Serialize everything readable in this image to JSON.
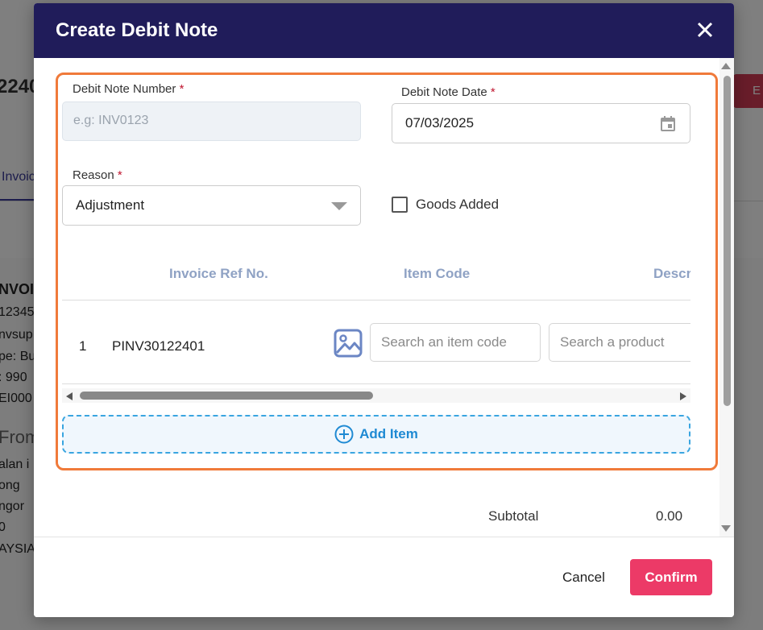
{
  "background": {
    "title": "2240",
    "edit_label": "E",
    "tab_label": "Invoic",
    "lines": [
      "NVOIC",
      "12345",
      "nvsup",
      "pe: Bu",
      ": 990",
      "EI000",
      "From",
      "alan i",
      "ong",
      "ngor",
      "0",
      "AYSIA"
    ]
  },
  "modal": {
    "title": "Create Debit Note",
    "close_icon": "close-icon",
    "fields": {
      "debit_note_number": {
        "label": "Debit Note Number",
        "required": "*",
        "placeholder": "e.g: INV0123",
        "value": ""
      },
      "debit_note_date": {
        "label": "Debit Note Date",
        "required": "*",
        "value": "07/03/2025"
      },
      "reason": {
        "label": "Reason",
        "required": "*",
        "value": "Adjustment"
      },
      "goods_added": {
        "label": "Goods Added",
        "checked": false
      }
    },
    "table": {
      "headers": [
        "Invoice Ref No.",
        "Item Code",
        "Descr"
      ],
      "rows": [
        {
          "index": "1",
          "invoice_ref": "PINV30122401",
          "item_code_placeholder": "Search an item code",
          "product_placeholder": "Search a product"
        }
      ]
    },
    "add_item_label": "Add Item",
    "subtotal": {
      "label": "Subtotal",
      "value": "0.00"
    },
    "footer": {
      "cancel_label": "Cancel",
      "confirm_label": "Confirm"
    }
  },
  "colors": {
    "header_bg": "#201c5a",
    "highlight": "#f07a3a",
    "confirm": "#ec3a67",
    "add_item": "#1f8ad3"
  }
}
